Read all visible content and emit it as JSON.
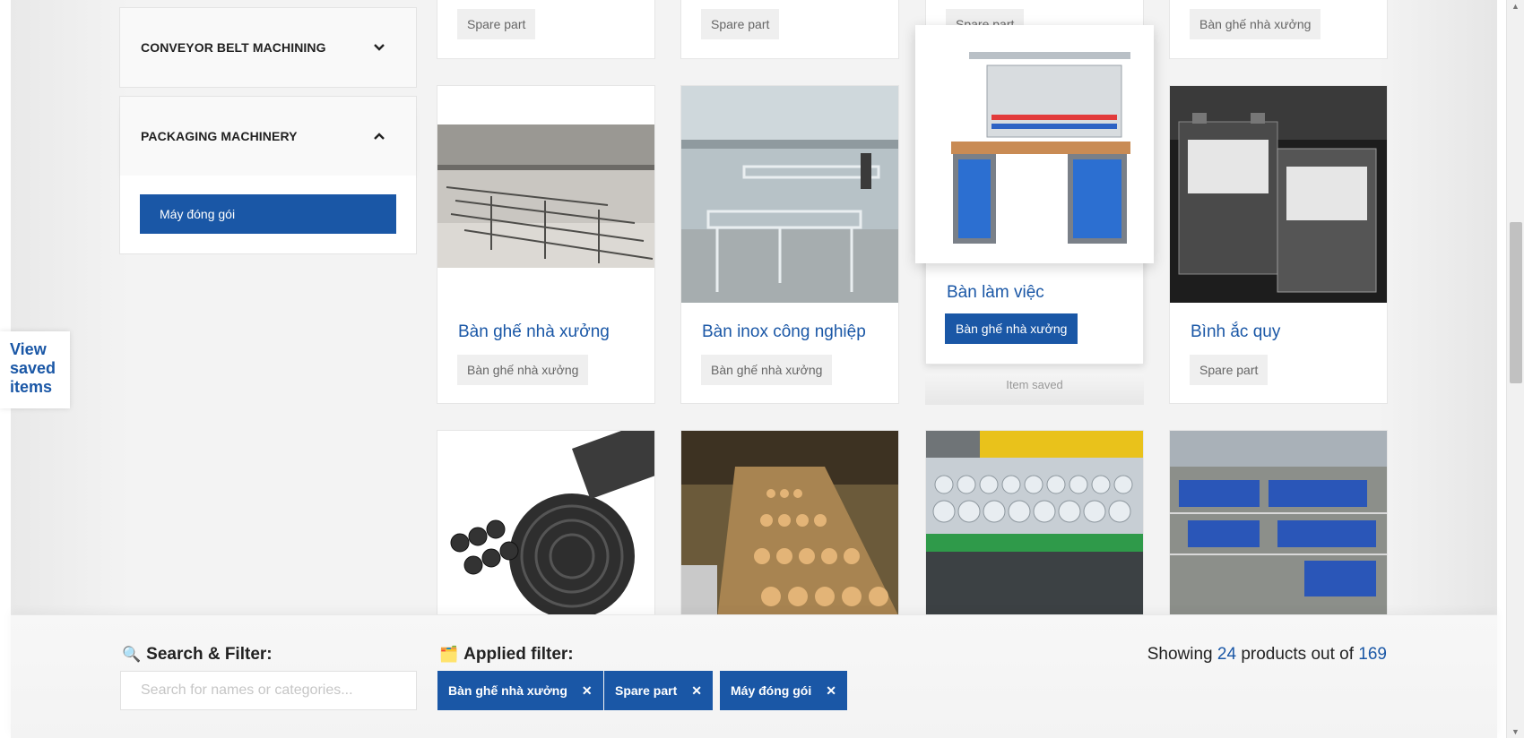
{
  "sidebar": {
    "sections": [
      {
        "label": "CONVEYOR BELT MACHINING",
        "expanded": false
      },
      {
        "label": "PACKAGING MACHINERY",
        "expanded": true,
        "items": [
          "Máy đóng gói"
        ]
      }
    ]
  },
  "saved_tab": {
    "label_line1": "View",
    "label_line2": "saved",
    "label_line3": "items"
  },
  "top_tags": [
    "Spare part",
    "Spare part",
    "Spare part",
    "Bàn ghế nhà xưởng"
  ],
  "products": [
    {
      "title": "Bàn ghế nhà xưởng",
      "tag": "Bàn ghế nhà xưởng"
    },
    {
      "title": "Bàn inox công nghiệp",
      "tag": "Bàn ghế nhà xưởng"
    },
    {
      "title": "Bàn làm việc",
      "tag": "Bàn ghế nhà xưởng",
      "saved_caption": "Item saved"
    },
    {
      "title": "Bình ắc quy",
      "tag": "Spare part"
    }
  ],
  "bottom": {
    "search_label": "Search & Filter:",
    "search_icon": "magnifier-icon",
    "search_placeholder": "Search for names or categories...",
    "applied_label": "Applied filter:",
    "applied_icon": "folder-icon",
    "chips": [
      "Bàn ghế nhà xưởng",
      "Spare part",
      "Máy đóng gói"
    ],
    "chip_remove": "✕",
    "showing_prefix": "Showing",
    "showing_count": "24",
    "showing_mid": "products out of",
    "showing_total": "169"
  },
  "colors": {
    "accent": "#1a57a6",
    "tag_bg": "#efefef",
    "page_bg": "#f3f3f3"
  }
}
